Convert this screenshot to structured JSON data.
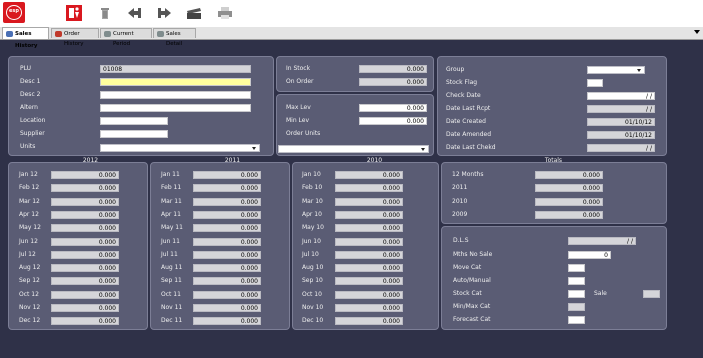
{
  "app": {
    "logo_text": "esp"
  },
  "tabs": [
    {
      "label": "Sales History",
      "color": "#4a6fb5"
    },
    {
      "label": "Order History",
      "color": "#c0392b"
    },
    {
      "label": "Current Period",
      "color": "#7f8c8d"
    },
    {
      "label": "Sales Detail",
      "color": "#7f8c8d"
    }
  ],
  "toolbar": {
    "icons": [
      "exit-icon",
      "delete-icon",
      "previous-icon",
      "next-icon",
      "clapper-icon",
      "printer-icon"
    ]
  },
  "product": {
    "plu_label": "PLU",
    "plu_value": "01008",
    "desc1_label": "Desc 1",
    "desc1_value": "",
    "desc2_label": "Desc 2",
    "desc2_value": "",
    "altern_label": "Altern",
    "altern_value": "",
    "location_label": "Location",
    "location_value": "",
    "supplier_label": "Supplier",
    "supplier_value": "",
    "units_label": "Units",
    "units_value": ""
  },
  "stock": {
    "in_stock_label": "In Stock",
    "in_stock_value": "0.000",
    "on_order_label": "On Order",
    "on_order_value": "0.000",
    "max_lev_label": "Max Lev",
    "max_lev_value": "0.000",
    "min_lev_label": "Min Lev",
    "min_lev_value": "0.000",
    "order_units_label": "Order Units",
    "order_units_value": ""
  },
  "group": {
    "group_label": "Group",
    "group_value": "",
    "stock_flag_label": "Stock Flag",
    "stock_flag_value": "",
    "check_date_label": "Check Date",
    "check_date_value": "/ /",
    "date_last_rcpt_label": "Date Last Rcpt",
    "date_last_rcpt_value": "/ /",
    "date_created_label": "Date Created",
    "date_created_value": "01/10/12",
    "date_amended_label": "Date Amended",
    "date_amended_value": "01/10/12",
    "date_last_chekd_label": "Date Last Chekd",
    "date_last_chekd_value": "/ /"
  },
  "years": [
    {
      "title": "2012",
      "rows": [
        {
          "label": "Jan 12",
          "value": "0.000"
        },
        {
          "label": "Feb 12",
          "value": "0.000"
        },
        {
          "label": "Mar 12",
          "value": "0.000"
        },
        {
          "label": "Apr 12",
          "value": "0.000"
        },
        {
          "label": "May 12",
          "value": "0.000"
        },
        {
          "label": "Jun 12",
          "value": "0.000"
        },
        {
          "label": "Jul 12",
          "value": "0.000"
        },
        {
          "label": "Aug 12",
          "value": "0.000"
        },
        {
          "label": "Sep 12",
          "value": "0.000"
        },
        {
          "label": "Oct 12",
          "value": "0.000"
        },
        {
          "label": "Nov 12",
          "value": "0.000"
        },
        {
          "label": "Dec 12",
          "value": "0.000"
        }
      ]
    },
    {
      "title": "2011",
      "rows": [
        {
          "label": "Jan 11",
          "value": "0.000"
        },
        {
          "label": "Feb 11",
          "value": "0.000"
        },
        {
          "label": "Mar 11",
          "value": "0.000"
        },
        {
          "label": "Apr 11",
          "value": "0.000"
        },
        {
          "label": "May 11",
          "value": "0.000"
        },
        {
          "label": "Jun 11",
          "value": "0.000"
        },
        {
          "label": "Jul 11",
          "value": "0.000"
        },
        {
          "label": "Aug 11",
          "value": "0.000"
        },
        {
          "label": "Sep 11",
          "value": "0.000"
        },
        {
          "label": "Oct 11",
          "value": "0.000"
        },
        {
          "label": "Nov 11",
          "value": "0.000"
        },
        {
          "label": "Dec 11",
          "value": "0.000"
        }
      ]
    },
    {
      "title": "2010",
      "rows": [
        {
          "label": "Jan 10",
          "value": "0.000"
        },
        {
          "label": "Feb 10",
          "value": "0.000"
        },
        {
          "label": "Mar 10",
          "value": "0.000"
        },
        {
          "label": "Apr 10",
          "value": "0.000"
        },
        {
          "label": "May 10",
          "value": "0.000"
        },
        {
          "label": "Jun 10",
          "value": "0.000"
        },
        {
          "label": "Jul 10",
          "value": "0.000"
        },
        {
          "label": "Aug 10",
          "value": "0.000"
        },
        {
          "label": "Sep 10",
          "value": "0.000"
        },
        {
          "label": "Oct 10",
          "value": "0.000"
        },
        {
          "label": "Nov 10",
          "value": "0.000"
        },
        {
          "label": "Dec 10",
          "value": "0.000"
        }
      ]
    }
  ],
  "totals": {
    "title": "Totals",
    "rows": [
      {
        "label": "12 Months",
        "value": "0.000"
      },
      {
        "label": "2011",
        "value": "0.000"
      },
      {
        "label": "2010",
        "value": "0.000"
      },
      {
        "label": "2009",
        "value": "0.000"
      }
    ]
  },
  "misc": {
    "dls_label": "D.L.S",
    "dls_value": "/ /",
    "mths_no_sale_label": "Mths No Sale",
    "mths_no_sale_value": "0",
    "move_cat_label": "Move Cat",
    "move_cat_value": "",
    "auto_manual_label": "Auto/Manual",
    "auto_manual_value": "",
    "stock_cat_label": "Stock Cat",
    "stock_cat_value": "",
    "sale_label": "Sale",
    "sale_value": "",
    "min_max_cat_label": "Min/Max Cat",
    "min_max_cat_value": "",
    "forecast_cat_label": "Forecast Cat",
    "forecast_cat_value": ""
  }
}
